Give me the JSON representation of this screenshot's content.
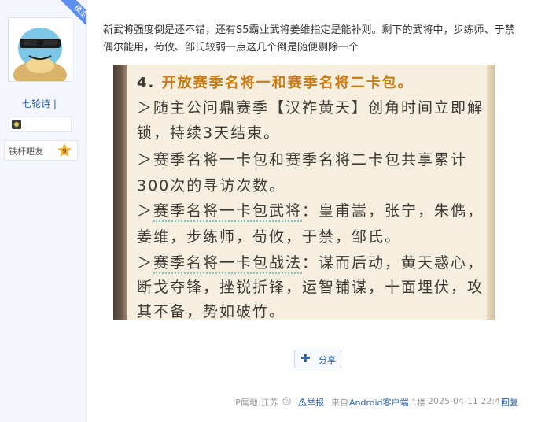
{
  "user": {
    "role_badge": "楼主",
    "username": "七轮诗",
    "title": "铁杆吧友",
    "level": "9"
  },
  "post": {
    "text": "新武将强度倒是还不错，还有S5霸业武将姜维指定是能补则。剩下的武将中，步练师、于禁偶尔能用，荀攸、邹氏较弱一点这几个倒是随便剔除一个",
    "image_lines": {
      "heading_num": "4.",
      "heading": "开放赛季名将一和赛季名将二卡包。",
      "l1": "＞随主公问鼎赛季【汉祚黄天】创角时间立即解",
      "l2": "锁，持续3天结束。",
      "l3": "＞赛季名将一卡包和赛季名将二卡包共享累计",
      "l4": "300次的寻访次数。",
      "l5_prefix": "＞",
      "l5_dotted": "赛季名将一卡包武将",
      "l5_suffix": "：皇甫嵩，张宁，朱儁，",
      "l6": "姜维，步练师，荀攸，于禁，邹氏。",
      "l7_prefix": "＞",
      "l7_dotted": "赛季名将一卡包战法",
      "l7_suffix": "：谋而后动，黄天惑心，",
      "l8": "断戈夺锋，挫锐折锋，运智铺谋，十面埋伏，攻",
      "l9": "其不备，势如破竹。"
    }
  },
  "actions": {
    "share_label": "分享"
  },
  "footer": {
    "ip": "IP属地:江苏",
    "report": "举报",
    "source_prefix": "来自",
    "source_client": "Android客户端",
    "floor": "1楼",
    "datetime": "2025-04-11 22:47",
    "reply": "回复"
  },
  "colors": {
    "link": "#2d64b3",
    "ribbon": "#5b8ff0",
    "heading_highlight": "#c97a12"
  }
}
